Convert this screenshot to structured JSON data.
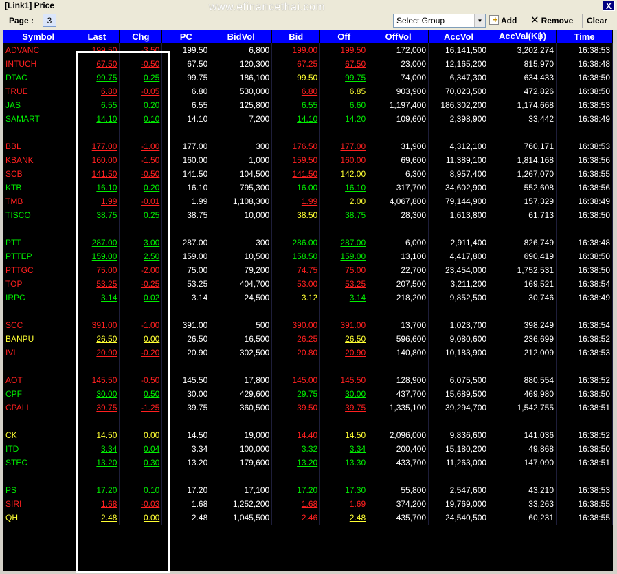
{
  "window": {
    "title": "[Link1] Price",
    "watermark": "www.efinancethai.com",
    "close_label": "X"
  },
  "toolbar": {
    "page_label": "Page :",
    "page_value": "3",
    "group_select": "Select Group",
    "add_label": "Add",
    "remove_label": "Remove",
    "clear_label": "Clear"
  },
  "colors": {
    "header_bg": "#0000ff",
    "grid_bg": "#000000",
    "up": "#00ee00",
    "down": "#ff2020",
    "unchanged": "#ffff33"
  },
  "columns": [
    "Symbol",
    "Last",
    "Chg",
    "PC",
    "BidVol",
    "Bid",
    "Off",
    "OffVol",
    "AccVol",
    "AccVal(K฿)",
    "Time"
  ],
  "rows": [
    {
      "sym": "ADVANC",
      "c": "red",
      "last": "199.50",
      "chg": "-3.50",
      "pc": "199.50",
      "bidvol": "6,800",
      "bid": "199.00",
      "bc": "red",
      "off": "199.50",
      "oc": "red",
      "offvol": "172,000",
      "accvol": "16,141,500",
      "accval": "3,202,274",
      "time": "16:38:53"
    },
    {
      "sym": "INTUCH",
      "c": "red",
      "last": "67.50",
      "chg": "-0.50",
      "pc": "67.50",
      "bidvol": "120,300",
      "bid": "67.25",
      "bc": "red",
      "off": "67.50",
      "oc": "red",
      "offvol": "23,000",
      "accvol": "12,165,200",
      "accval": "815,970",
      "time": "16:38:48"
    },
    {
      "sym": "DTAC",
      "c": "green",
      "last": "99.75",
      "chg": "0.25",
      "pc": "99.75",
      "bidvol": "186,100",
      "bid": "99.50",
      "bc": "yellow",
      "off": "99.75",
      "oc": "green",
      "offvol": "74,000",
      "accvol": "6,347,300",
      "accval": "634,433",
      "time": "16:38:50"
    },
    {
      "sym": "TRUE",
      "c": "red",
      "last": "6.80",
      "chg": "-0.05",
      "pc": "6.80",
      "bidvol": "530,000",
      "bid": "6.80",
      "bc": "red",
      "off": "6.85",
      "oc": "yellow",
      "offvol": "903,900",
      "accvol": "70,023,500",
      "accval": "472,826",
      "time": "16:38:50"
    },
    {
      "sym": "JAS",
      "c": "green",
      "last": "6.55",
      "chg": "0.20",
      "pc": "6.55",
      "bidvol": "125,800",
      "bid": "6.55",
      "bc": "green",
      "off": "6.60",
      "oc": "green",
      "offvol": "1,197,400",
      "accvol": "186,302,200",
      "accval": "1,174,668",
      "time": "16:38:53"
    },
    {
      "sym": "SAMART",
      "c": "green",
      "last": "14.10",
      "chg": "0.10",
      "pc": "14.10",
      "bidvol": "7,200",
      "bid": "14.10",
      "bc": "green",
      "off": "14.20",
      "oc": "green",
      "offvol": "109,600",
      "accvol": "2,398,900",
      "accval": "33,442",
      "time": "16:38:49"
    },
    {
      "blank": true
    },
    {
      "sym": "BBL",
      "c": "red",
      "last": "177.00",
      "chg": "-1.00",
      "pc": "177.00",
      "bidvol": "300",
      "bid": "176.50",
      "bc": "red",
      "off": "177.00",
      "oc": "red",
      "offvol": "31,900",
      "accvol": "4,312,100",
      "accval": "760,171",
      "time": "16:38:53"
    },
    {
      "sym": "KBANK",
      "c": "red",
      "last": "160.00",
      "chg": "-1.50",
      "pc": "160.00",
      "bidvol": "1,000",
      "bid": "159.50",
      "bc": "red",
      "off": "160.00",
      "oc": "red",
      "offvol": "69,600",
      "accvol": "11,389,100",
      "accval": "1,814,168",
      "time": "16:38:56"
    },
    {
      "sym": "SCB",
      "c": "red",
      "last": "141.50",
      "chg": "-0.50",
      "pc": "141.50",
      "bidvol": "104,500",
      "bid": "141.50",
      "bc": "red",
      "off": "142.00",
      "oc": "yellow",
      "offvol": "6,300",
      "accvol": "8,957,400",
      "accval": "1,267,070",
      "time": "16:38:55"
    },
    {
      "sym": "KTB",
      "c": "green",
      "last": "16.10",
      "chg": "0.20",
      "pc": "16.10",
      "bidvol": "795,300",
      "bid": "16.00",
      "bc": "green",
      "off": "16.10",
      "oc": "green",
      "offvol": "317,700",
      "accvol": "34,602,900",
      "accval": "552,608",
      "time": "16:38:56"
    },
    {
      "sym": "TMB",
      "c": "red",
      "last": "1.99",
      "chg": "-0.01",
      "pc": "1.99",
      "bidvol": "1,108,300",
      "bid": "1.99",
      "bc": "red",
      "off": "2.00",
      "oc": "yellow",
      "offvol": "4,067,800",
      "accvol": "79,144,900",
      "accval": "157,329",
      "time": "16:38:49"
    },
    {
      "sym": "TISCO",
      "c": "green",
      "last": "38.75",
      "chg": "0.25",
      "pc": "38.75",
      "bidvol": "10,000",
      "bid": "38.50",
      "bc": "yellow",
      "off": "38.75",
      "oc": "green",
      "offvol": "28,300",
      "accvol": "1,613,800",
      "accval": "61,713",
      "time": "16:38:50"
    },
    {
      "blank": true
    },
    {
      "sym": "PTT",
      "c": "green",
      "last": "287.00",
      "chg": "3.00",
      "pc": "287.00",
      "bidvol": "300",
      "bid": "286.00",
      "bc": "green",
      "off": "287.00",
      "oc": "green",
      "offvol": "6,000",
      "accvol": "2,911,400",
      "accval": "826,749",
      "time": "16:38:48"
    },
    {
      "sym": "PTTEP",
      "c": "green",
      "last": "159.00",
      "chg": "2.50",
      "pc": "159.00",
      "bidvol": "10,500",
      "bid": "158.50",
      "bc": "green",
      "off": "159.00",
      "oc": "green",
      "offvol": "13,100",
      "accvol": "4,417,800",
      "accval": "690,419",
      "time": "16:38:50"
    },
    {
      "sym": "PTTGC",
      "c": "red",
      "last": "75.00",
      "chg": "-2.00",
      "pc": "75.00",
      "bidvol": "79,200",
      "bid": "74.75",
      "bc": "red",
      "off": "75.00",
      "oc": "red",
      "offvol": "22,700",
      "accvol": "23,454,000",
      "accval": "1,752,531",
      "time": "16:38:50"
    },
    {
      "sym": "TOP",
      "c": "red",
      "last": "53.25",
      "chg": "-0.25",
      "pc": "53.25",
      "bidvol": "404,700",
      "bid": "53.00",
      "bc": "red",
      "off": "53.25",
      "oc": "red",
      "offvol": "207,500",
      "accvol": "3,211,200",
      "accval": "169,521",
      "time": "16:38:54"
    },
    {
      "sym": "IRPC",
      "c": "green",
      "last": "3.14",
      "chg": "0.02",
      "pc": "3.14",
      "bidvol": "24,500",
      "bid": "3.12",
      "bc": "yellow",
      "off": "3.14",
      "oc": "green",
      "offvol": "218,200",
      "accvol": "9,852,500",
      "accval": "30,746",
      "time": "16:38:49"
    },
    {
      "blank": true
    },
    {
      "sym": "SCC",
      "c": "red",
      "last": "391.00",
      "chg": "-1.00",
      "pc": "391.00",
      "bidvol": "500",
      "bid": "390.00",
      "bc": "red",
      "off": "391.00",
      "oc": "red",
      "offvol": "13,700",
      "accvol": "1,023,700",
      "accval": "398,249",
      "time": "16:38:54"
    },
    {
      "sym": "BANPU",
      "c": "yellow",
      "last": "26.50",
      "chg": "0.00",
      "pc": "26.50",
      "bidvol": "16,500",
      "bid": "26.25",
      "bc": "red",
      "off": "26.50",
      "oc": "yellow",
      "offvol": "596,600",
      "accvol": "9,080,600",
      "accval": "236,699",
      "time": "16:38:52"
    },
    {
      "sym": "IVL",
      "c": "red",
      "last": "20.90",
      "chg": "-0.20",
      "pc": "20.90",
      "bidvol": "302,500",
      "bid": "20.80",
      "bc": "red",
      "off": "20.90",
      "oc": "red",
      "offvol": "140,800",
      "accvol": "10,183,900",
      "accval": "212,009",
      "time": "16:38:53"
    },
    {
      "blank": true
    },
    {
      "sym": "AOT",
      "c": "red",
      "last": "145.50",
      "chg": "-0.50",
      "pc": "145.50",
      "bidvol": "17,800",
      "bid": "145.00",
      "bc": "red",
      "off": "145.50",
      "oc": "red",
      "offvol": "128,900",
      "accvol": "6,075,500",
      "accval": "880,554",
      "time": "16:38:52"
    },
    {
      "sym": "CPF",
      "c": "green",
      "last": "30.00",
      "chg": "0.50",
      "pc": "30.00",
      "bidvol": "429,600",
      "bid": "29.75",
      "bc": "green",
      "off": "30.00",
      "oc": "green",
      "offvol": "437,700",
      "accvol": "15,689,500",
      "accval": "469,980",
      "time": "16:38:50"
    },
    {
      "sym": "CPALL",
      "c": "red",
      "last": "39.75",
      "chg": "-1.25",
      "pc": "39.75",
      "bidvol": "360,500",
      "bid": "39.50",
      "bc": "red",
      "off": "39.75",
      "oc": "red",
      "offvol": "1,335,100",
      "accvol": "39,294,700",
      "accval": "1,542,755",
      "time": "16:38:51"
    },
    {
      "blank": true
    },
    {
      "sym": "CK",
      "c": "yellow",
      "last": "14.50",
      "chg": "0.00",
      "pc": "14.50",
      "bidvol": "19,000",
      "bid": "14.40",
      "bc": "red",
      "off": "14.50",
      "oc": "yellow",
      "offvol": "2,096,000",
      "accvol": "9,836,600",
      "accval": "141,036",
      "time": "16:38:52"
    },
    {
      "sym": "ITD",
      "c": "green",
      "last": "3.34",
      "chg": "0.04",
      "pc": "3.34",
      "bidvol": "100,000",
      "bid": "3.32",
      "bc": "green",
      "off": "3.34",
      "oc": "green",
      "offvol": "200,400",
      "accvol": "15,180,200",
      "accval": "49,868",
      "time": "16:38:50"
    },
    {
      "sym": "STEC",
      "c": "green",
      "last": "13.20",
      "chg": "0.30",
      "pc": "13.20",
      "bidvol": "179,600",
      "bid": "13.20",
      "bc": "green",
      "off": "13.30",
      "oc": "green",
      "offvol": "433,700",
      "accvol": "11,263,000",
      "accval": "147,090",
      "time": "16:38:51"
    },
    {
      "blank": true
    },
    {
      "sym": "PS",
      "c": "green",
      "last": "17.20",
      "chg": "0.10",
      "pc": "17.20",
      "bidvol": "17,100",
      "bid": "17.20",
      "bc": "green",
      "off": "17.30",
      "oc": "green",
      "offvol": "55,800",
      "accvol": "2,547,600",
      "accval": "43,210",
      "time": "16:38:53"
    },
    {
      "sym": "SIRI",
      "c": "red",
      "last": "1.68",
      "chg": "-0.03",
      "pc": "1.68",
      "bidvol": "1,252,200",
      "bid": "1.68",
      "bc": "red",
      "off": "1.69",
      "oc": "red",
      "offvol": "374,200",
      "accvol": "19,769,000",
      "accval": "33,263",
      "time": "16:38:55"
    },
    {
      "sym": "QH",
      "c": "yellow",
      "last": "2.48",
      "chg": "0.00",
      "pc": "2.48",
      "bidvol": "1,045,500",
      "bid": "2.46",
      "bc": "red",
      "off": "2.48",
      "oc": "yellow",
      "offvol": "435,700",
      "accvol": "24,540,500",
      "accval": "60,231",
      "time": "16:38:55"
    }
  ]
}
